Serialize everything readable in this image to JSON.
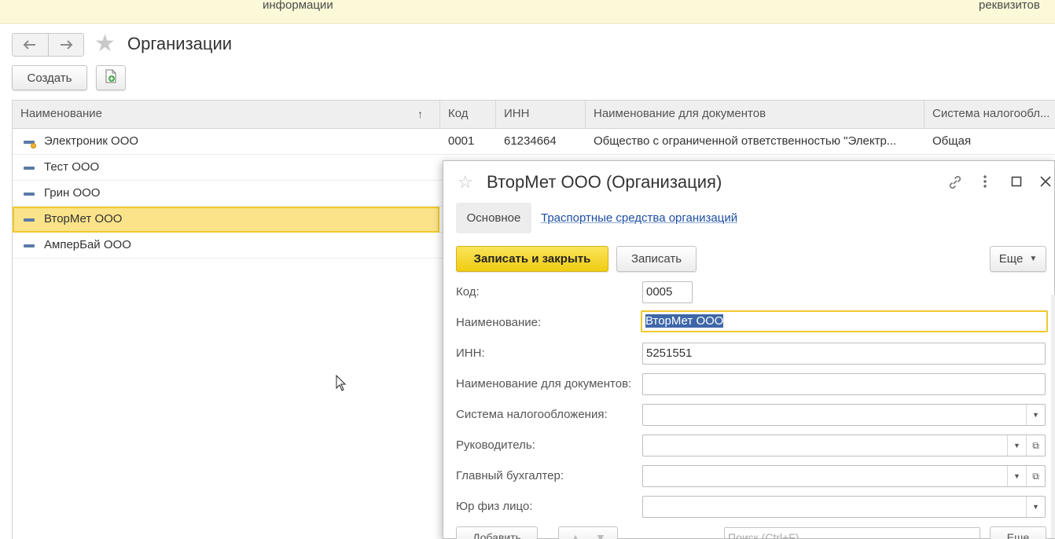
{
  "topstrip": {
    "left_text": "информации",
    "right_text": "реквизитов"
  },
  "nav": {
    "back_icon": "arrow-left-icon",
    "forward_icon": "arrow-right-icon",
    "back_glyph": "🡐",
    "forward_glyph": "🡒"
  },
  "page": {
    "title": "Организации",
    "favorite_icon": "star-icon"
  },
  "toolbar": {
    "create_label": "Создать",
    "copy_icon": "copy-doc-icon"
  },
  "list": {
    "columns": [
      "Наименование",
      "Код",
      "ИНН",
      "Наименование для документов",
      "Система налогообл..."
    ],
    "sort_indicator": "↑",
    "rows": [
      {
        "name": "Электроник ООО",
        "code": "0001",
        "inn": "61234664",
        "doc_name": "Общество с ограниченной ответственностью \"Электр...",
        "tax": "Общая",
        "main": true
      },
      {
        "name": "Тест ООО",
        "code": "",
        "inn": "",
        "doc_name": "",
        "tax": ""
      },
      {
        "name": "Грин ООО",
        "code": "",
        "inn": "",
        "doc_name": "",
        "tax": ""
      },
      {
        "name": "ВторМет ООО",
        "code": "",
        "inn": "",
        "doc_name": "",
        "tax": "",
        "selected": true
      },
      {
        "name": "АмперБай ООО",
        "code": "",
        "inn": "",
        "doc_name": "",
        "tax": ""
      }
    ]
  },
  "dialog": {
    "title": "ВторМет ООО (Организация)",
    "icons": {
      "favorite": "star-icon",
      "link": "link-icon",
      "menu": "more-vertical-icon",
      "maximize": "maximize-icon",
      "close": "close-icon"
    },
    "tabs": {
      "main": "Основное",
      "link": "Траспортные средства организаций"
    },
    "buttons": {
      "save_close": "Записать и закрыть",
      "save": "Записать",
      "more": "Еще"
    },
    "fields": {
      "code": {
        "label": "Код:",
        "value": "0005"
      },
      "name": {
        "label": "Наименование:",
        "value": "ВторМет ООО"
      },
      "inn": {
        "label": "ИНН:",
        "value": "5251551"
      },
      "doc_name": {
        "label": "Наименование для документов:",
        "value": ""
      },
      "tax_system": {
        "label": "Система налогообложения:",
        "value": ""
      },
      "director": {
        "label": "Руководитель:",
        "value": ""
      },
      "accountant": {
        "label": "Главный бухгалтер:",
        "value": ""
      },
      "person_type": {
        "label": "Юр физ лицо:",
        "value": ""
      }
    },
    "bottom": {
      "add_label": "Добавить",
      "search_placeholder": "Поиск (Ctrl+F)",
      "more_label": "Еще"
    }
  },
  "colors": {
    "accent_yellow": "#f0cc12",
    "selection_yellow": "#fbe38a",
    "link_blue": "#1c4ea3",
    "text_selection": "#3e67a8"
  }
}
